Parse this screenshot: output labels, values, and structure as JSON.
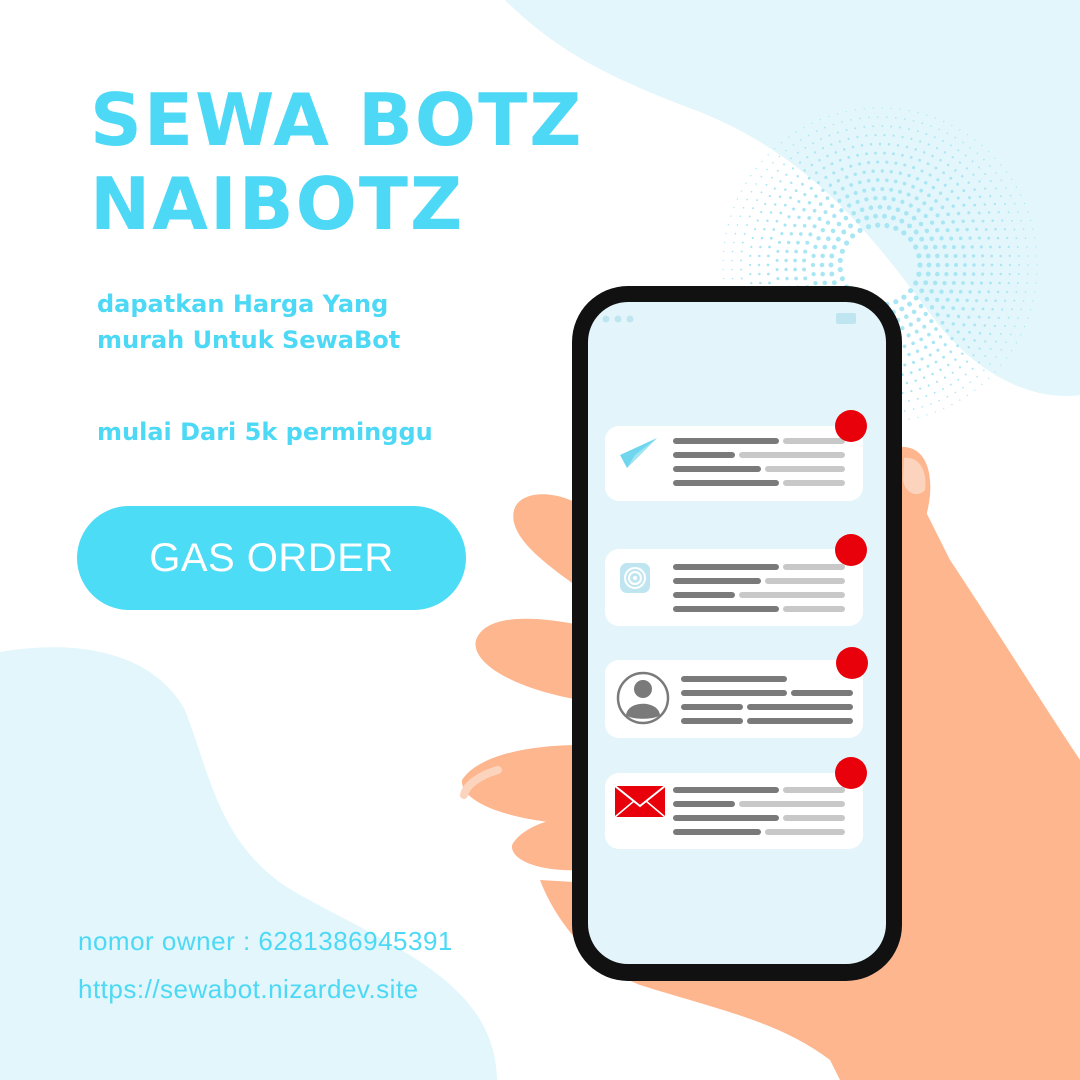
{
  "headline": {
    "line1": "SEWA BOTZ",
    "line2": "NAIBOTZ"
  },
  "subtitle": {
    "line1": "dapatkan Harga Yang",
    "line2": "murah Untuk SewaBot",
    "price": "mulai Dari 5k perminggu"
  },
  "cta": {
    "label": "GAS ORDER"
  },
  "contact": {
    "owner": "nomor owner : 6281386945391",
    "url": "https://sewabot.nizardev.site"
  },
  "phone": {
    "notifications": [
      {
        "icon": "paper-plane-icon",
        "badge_color": "#e8000b"
      },
      {
        "icon": "spiral-app-icon",
        "badge_color": "#e8000b"
      },
      {
        "icon": "user-avatar-icon",
        "badge_color": "#e8000b"
      },
      {
        "icon": "envelope-icon",
        "badge_color": "#e8000b"
      }
    ]
  },
  "colors": {
    "accent": "#4dd9f5",
    "blob": "#e2f6fb",
    "skin": "#fdb68e",
    "phone_frame": "#111111",
    "screen": "#e3f5fa",
    "badge": "#e8000b"
  }
}
